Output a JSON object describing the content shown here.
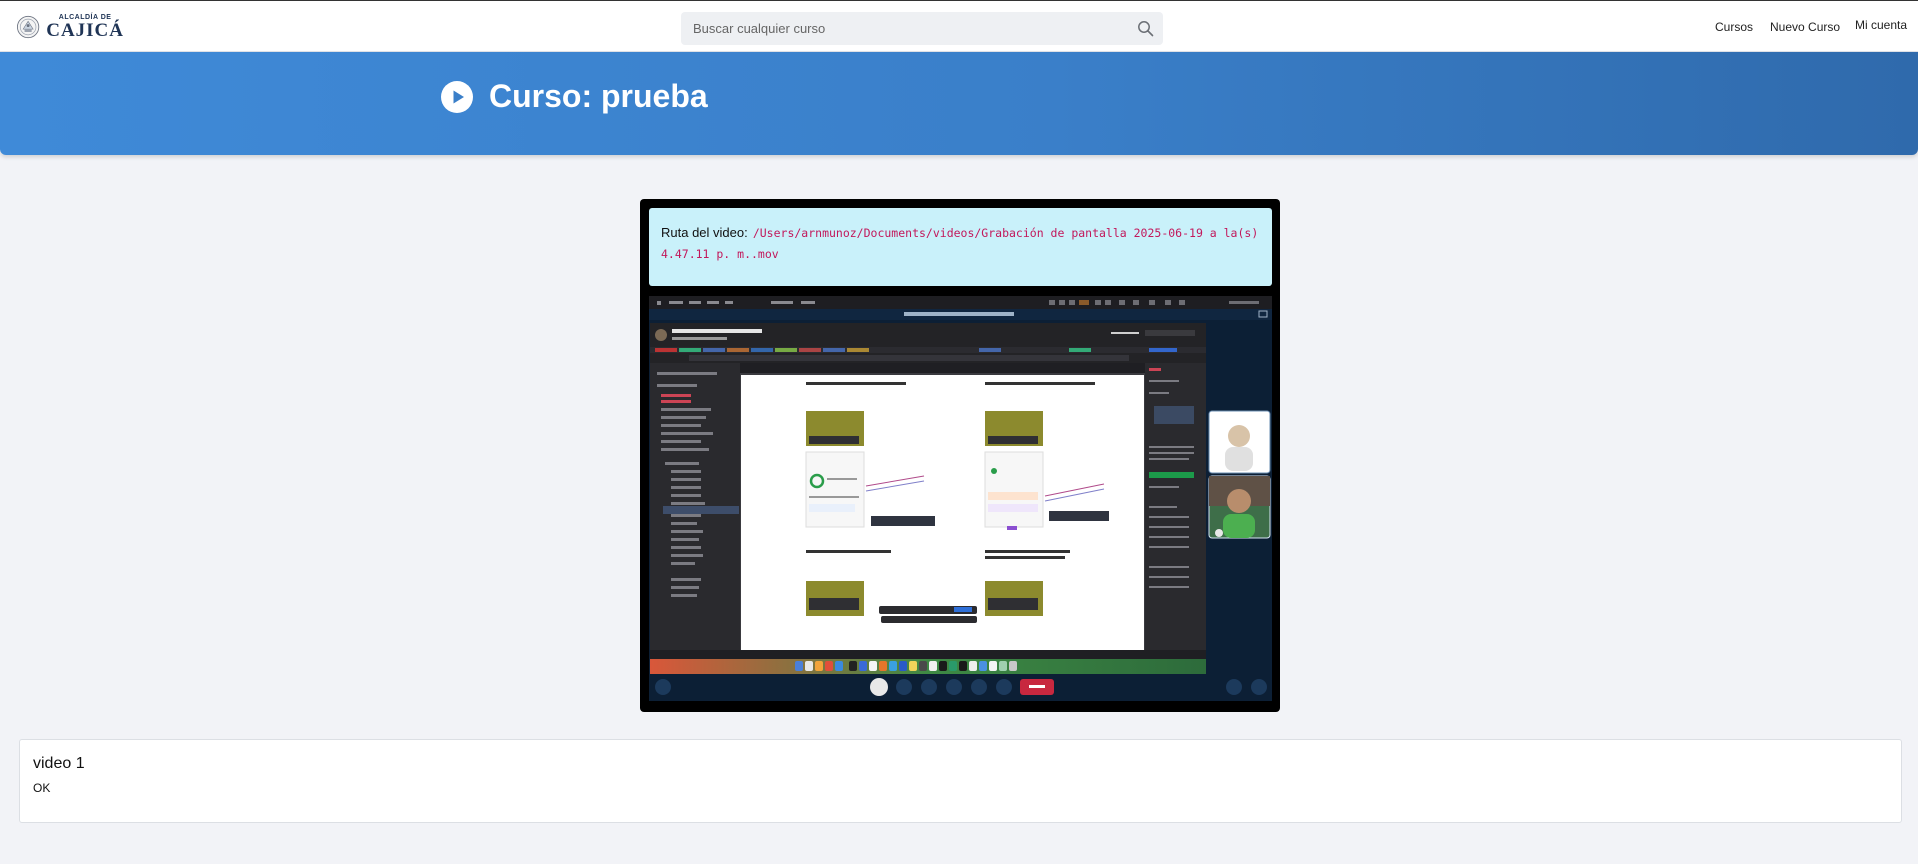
{
  "brand": {
    "logo_small": "ALCALDÍA DE",
    "logo_name": "CAJICÁ",
    "color": "#1f3455"
  },
  "search": {
    "placeholder": "Buscar cualquier curso",
    "icon": "search-icon"
  },
  "nav": {
    "cursos": "Cursos",
    "nuevo_curso": "Nuevo Curso",
    "mi_cuenta": "Mi cuenta"
  },
  "hero": {
    "title": "Curso: prueba",
    "icon": "play-circle-icon",
    "color": "#3a7fc9"
  },
  "video": {
    "path_label": "Ruta del video:",
    "path_value": "/Users/arnmunoz/Documents/videos/Grabación de pantalla 2025-06-19 a la(s) 4.47.11 p. m..mov",
    "path_color": "#c2185b",
    "path_bg": "#c9f1fa"
  },
  "item": {
    "title": "video 1",
    "status": "OK"
  }
}
